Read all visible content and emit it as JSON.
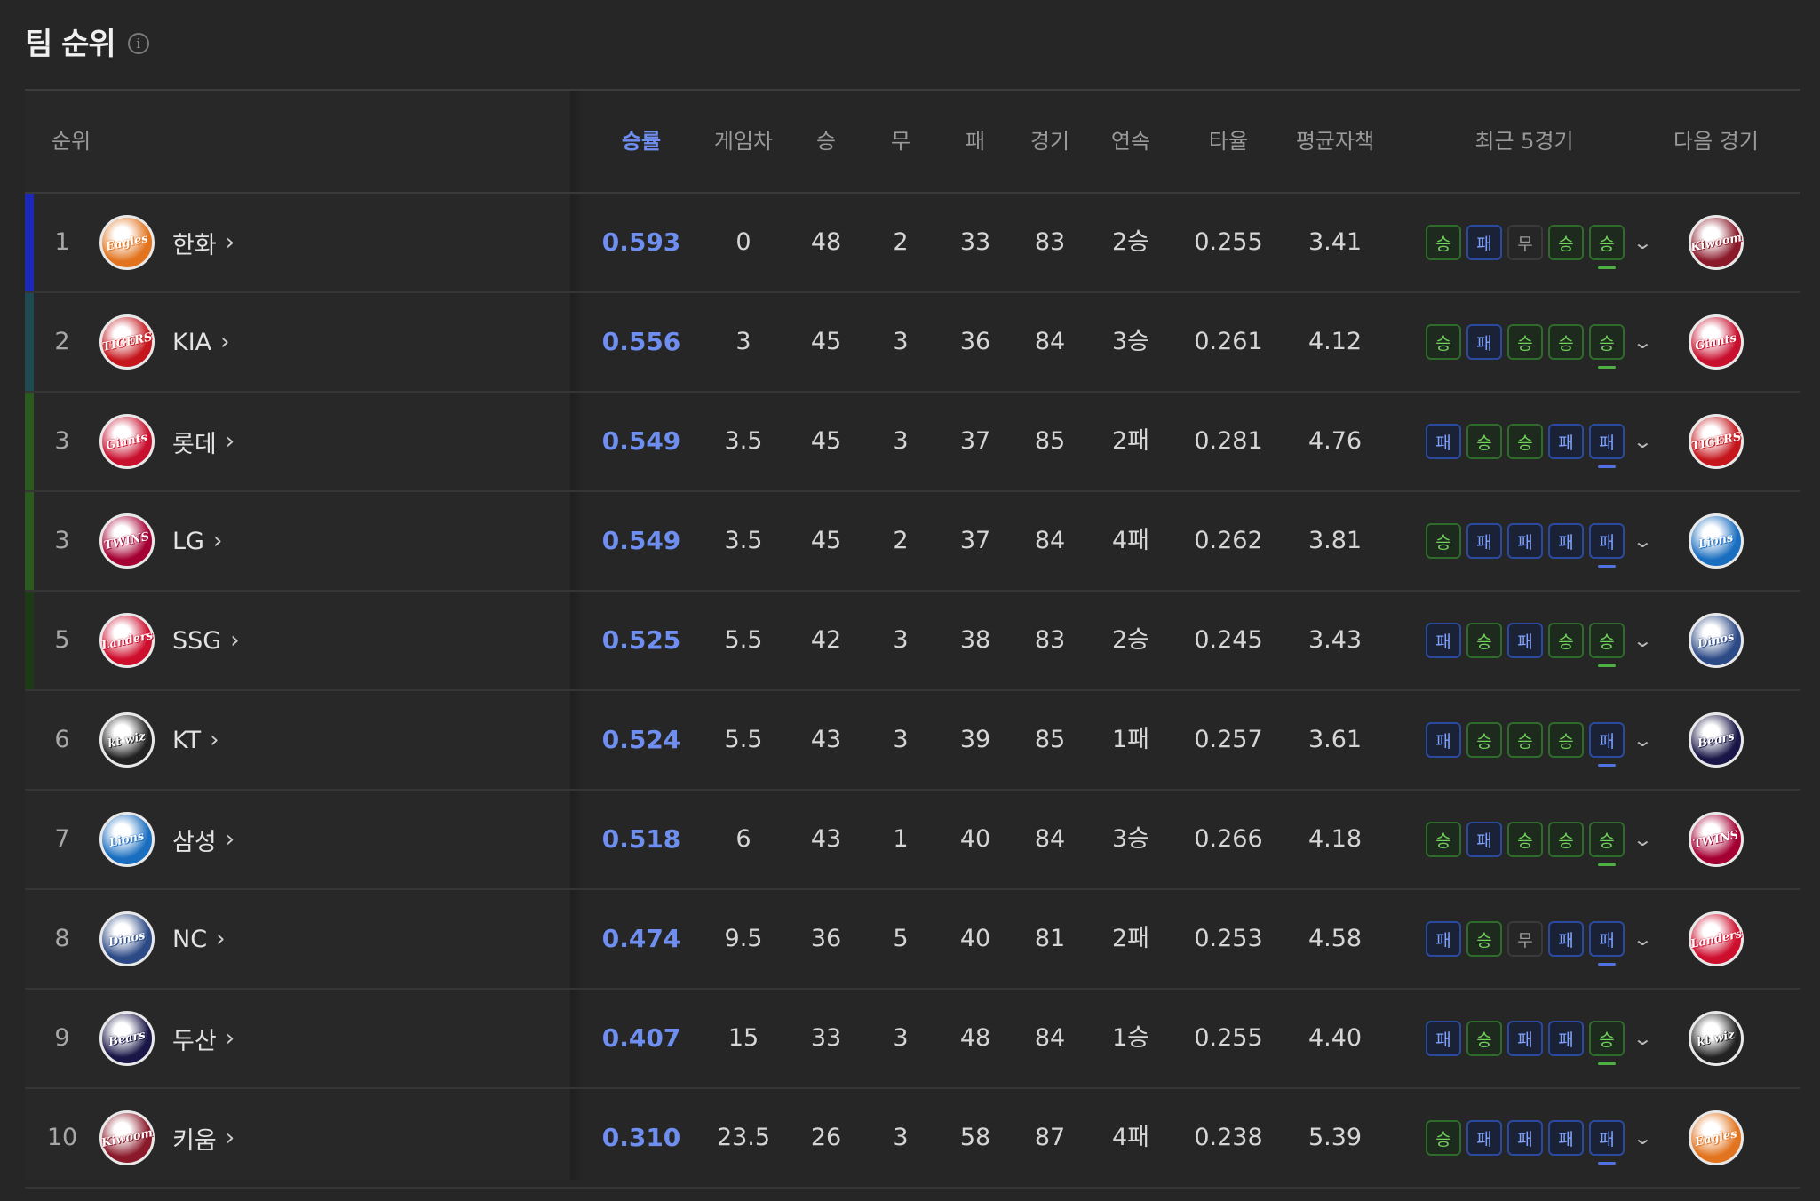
{
  "page": {
    "title": "팀 순위",
    "info_icon": "i"
  },
  "columns": {
    "rank": "순위",
    "win_pct": "승률",
    "games_behind": "게임차",
    "wins": "승",
    "draws": "무",
    "losses": "패",
    "games": "경기",
    "streak": "연속",
    "batting_avg": "타율",
    "era": "평균자책",
    "recent5": "최근 5경기",
    "next_game": "다음 경기"
  },
  "colors": {
    "accent": "#6f8ff0",
    "win": "#6fd25a",
    "loss": "#7fa2ff",
    "rank_bar_1": "#1c28b8",
    "rank_bar_2": "#1f4a52",
    "rank_bar_3": "#2a5a1f",
    "rank_bar_5": "#1d3a16"
  },
  "teams": [
    {
      "rank": "1",
      "name": "한화",
      "logo": "Eagles",
      "logo_color": "#e2741f",
      "bar": "#1c28b8",
      "pct": "0.593",
      "gb": "0",
      "w": "48",
      "d": "2",
      "l": "33",
      "g": "83",
      "streak": "2승",
      "avg": "0.255",
      "era": "3.41",
      "recent": [
        "승",
        "패",
        "무",
        "승",
        "승"
      ],
      "next_logo": "Kiwoom",
      "next_color": "#8a1a2a"
    },
    {
      "rank": "2",
      "name": "KIA",
      "logo": "TIGERS",
      "logo_color": "#c4161c",
      "bar": "#1f4a52",
      "pct": "0.556",
      "gb": "3",
      "w": "45",
      "d": "3",
      "l": "36",
      "g": "84",
      "streak": "3승",
      "avg": "0.261",
      "era": "4.12",
      "recent": [
        "승",
        "패",
        "승",
        "승",
        "승"
      ],
      "next_logo": "Giants",
      "next_color": "#c8102e"
    },
    {
      "rank": "3",
      "name": "롯데",
      "logo": "Giants",
      "logo_color": "#c8102e",
      "bar": "#2a5a1f",
      "pct": "0.549",
      "gb": "3.5",
      "w": "45",
      "d": "3",
      "l": "37",
      "g": "85",
      "streak": "2패",
      "avg": "0.281",
      "era": "4.76",
      "recent": [
        "패",
        "승",
        "승",
        "패",
        "패"
      ],
      "next_logo": "TIGERS",
      "next_color": "#c4161c"
    },
    {
      "rank": "3",
      "name": "LG",
      "logo": "TWINS",
      "logo_color": "#a50034",
      "bar": "#2a5a1f",
      "pct": "0.549",
      "gb": "3.5",
      "w": "45",
      "d": "2",
      "l": "37",
      "g": "84",
      "streak": "4패",
      "avg": "0.262",
      "era": "3.81",
      "recent": [
        "승",
        "패",
        "패",
        "패",
        "패"
      ],
      "next_logo": "Lions",
      "next_color": "#1a6ec0"
    },
    {
      "rank": "5",
      "name": "SSG",
      "logo": "Landers",
      "logo_color": "#ce0e2d",
      "bar": "#1d3a16",
      "pct": "0.525",
      "gb": "5.5",
      "w": "42",
      "d": "3",
      "l": "38",
      "g": "83",
      "streak": "2승",
      "avg": "0.245",
      "era": "3.43",
      "recent": [
        "패",
        "승",
        "패",
        "승",
        "승"
      ],
      "next_logo": "Dinos",
      "next_color": "#2c4a86"
    },
    {
      "rank": "6",
      "name": "KT",
      "logo": "kt wiz",
      "logo_color": "#222222",
      "bar": "",
      "pct": "0.524",
      "gb": "5.5",
      "w": "43",
      "d": "3",
      "l": "39",
      "g": "85",
      "streak": "1패",
      "avg": "0.257",
      "era": "3.61",
      "recent": [
        "패",
        "승",
        "승",
        "승",
        "패"
      ],
      "next_logo": "Bears",
      "next_color": "#1a1748"
    },
    {
      "rank": "7",
      "name": "삼성",
      "logo": "Lions",
      "logo_color": "#1a6ec0",
      "bar": "",
      "pct": "0.518",
      "gb": "6",
      "w": "43",
      "d": "1",
      "l": "40",
      "g": "84",
      "streak": "3승",
      "avg": "0.266",
      "era": "4.18",
      "recent": [
        "승",
        "패",
        "승",
        "승",
        "승"
      ],
      "next_logo": "TWINS",
      "next_color": "#a50034"
    },
    {
      "rank": "8",
      "name": "NC",
      "logo": "Dinos",
      "logo_color": "#2c4a86",
      "bar": "",
      "pct": "0.474",
      "gb": "9.5",
      "w": "36",
      "d": "5",
      "l": "40",
      "g": "81",
      "streak": "2패",
      "avg": "0.253",
      "era": "4.58",
      "recent": [
        "패",
        "승",
        "무",
        "패",
        "패"
      ],
      "next_logo": "Landers",
      "next_color": "#ce0e2d"
    },
    {
      "rank": "9",
      "name": "두산",
      "logo": "Bears",
      "logo_color": "#1a1748",
      "bar": "",
      "pct": "0.407",
      "gb": "15",
      "w": "33",
      "d": "3",
      "l": "48",
      "g": "84",
      "streak": "1승",
      "avg": "0.255",
      "era": "4.40",
      "recent": [
        "패",
        "승",
        "패",
        "패",
        "승"
      ],
      "next_logo": "kt wiz",
      "next_color": "#222222"
    },
    {
      "rank": "10",
      "name": "키움",
      "logo": "Kiwoom",
      "logo_color": "#8a1a2a",
      "bar": "",
      "pct": "0.310",
      "gb": "23.5",
      "w": "26",
      "d": "3",
      "l": "58",
      "g": "87",
      "streak": "4패",
      "avg": "0.238",
      "era": "5.39",
      "recent": [
        "승",
        "패",
        "패",
        "패",
        "패"
      ],
      "next_logo": "Eagles",
      "next_color": "#e2741f"
    }
  ]
}
